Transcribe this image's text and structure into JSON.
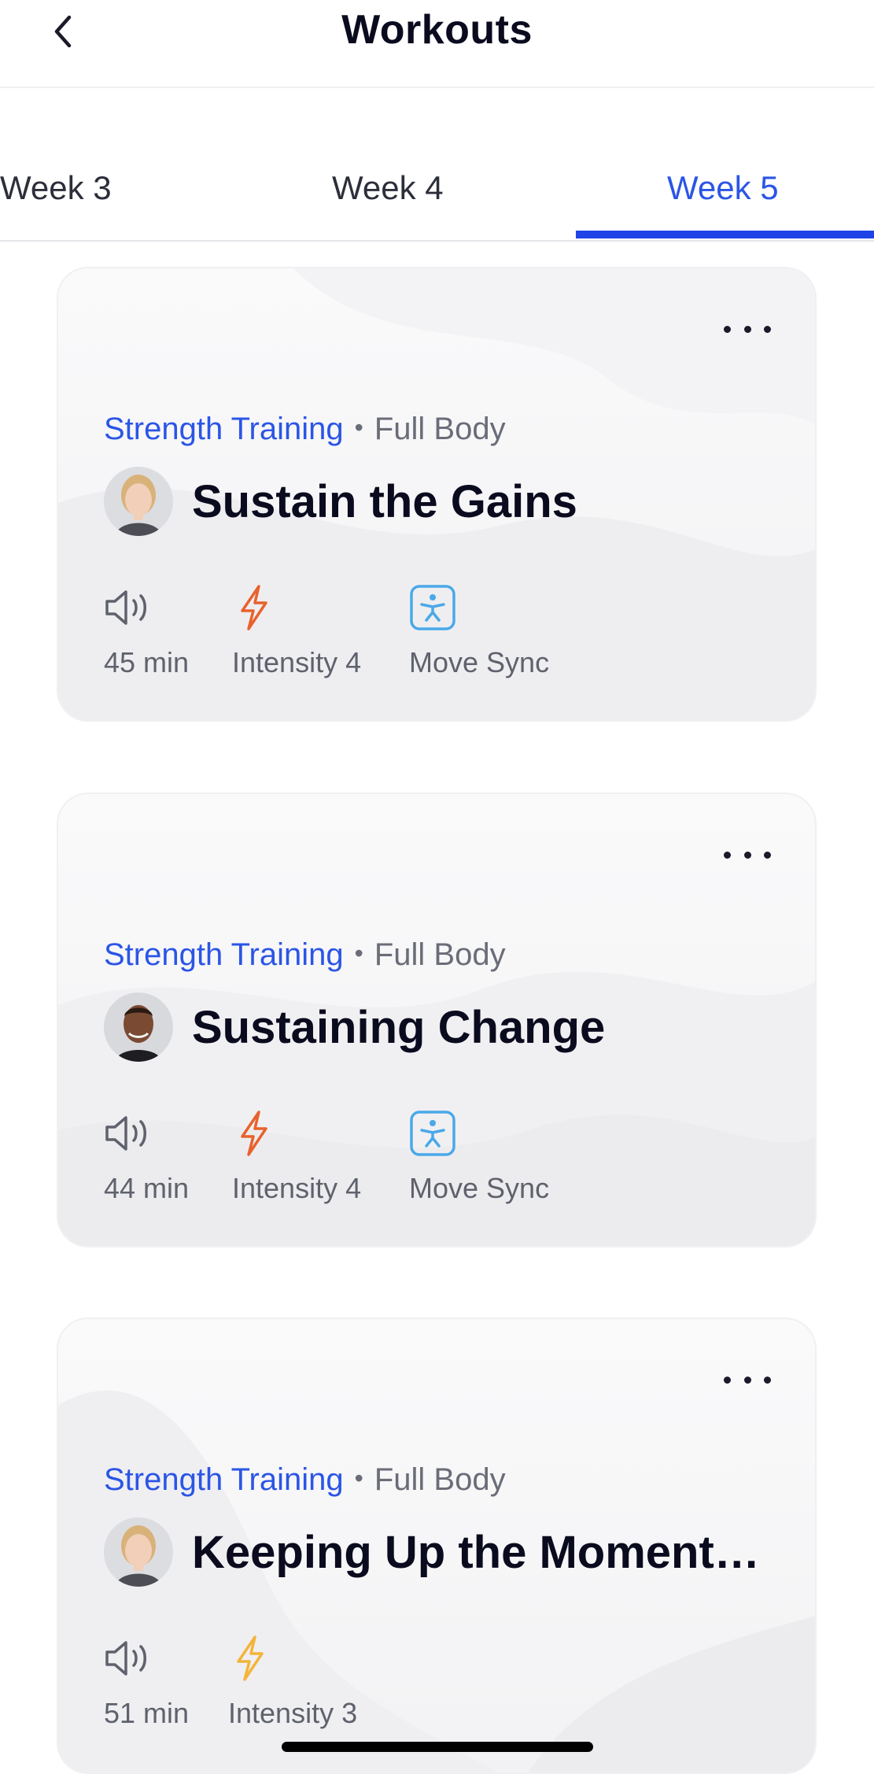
{
  "header": {
    "title": "Workouts",
    "back_icon": "chevron-left-icon"
  },
  "tabs": [
    {
      "label": "Week 3",
      "active": false
    },
    {
      "label": "Week 4",
      "active": false
    },
    {
      "label": "Week 5",
      "active": true
    }
  ],
  "colors": {
    "accent": "#2b55e6",
    "tab_underline": "#1f43e6",
    "intensity_4": "#e8622c",
    "intensity_3": "#f4b43a",
    "move_sync": "#4aa8e8"
  },
  "workouts": [
    {
      "category": "Strength Training",
      "separator": "•",
      "body_part": "Full Body",
      "title": "Sustain the Gains",
      "instructor_avatar": "instructor-female-avatar",
      "duration": "45 min",
      "intensity": "Intensity 4",
      "move_sync": "Move Sync"
    },
    {
      "category": "Strength Training",
      "separator": "•",
      "body_part": "Full Body",
      "title": "Sustaining Change",
      "instructor_avatar": "instructor-male-avatar",
      "duration": "44 min",
      "intensity": "Intensity 4",
      "move_sync": "Move Sync"
    },
    {
      "category": "Strength Training",
      "separator": "•",
      "body_part": "Full Body",
      "title": "Keeping Up the Moment…",
      "instructor_avatar": "instructor-female-avatar",
      "duration": "51 min",
      "intensity": "Intensity 3"
    }
  ]
}
